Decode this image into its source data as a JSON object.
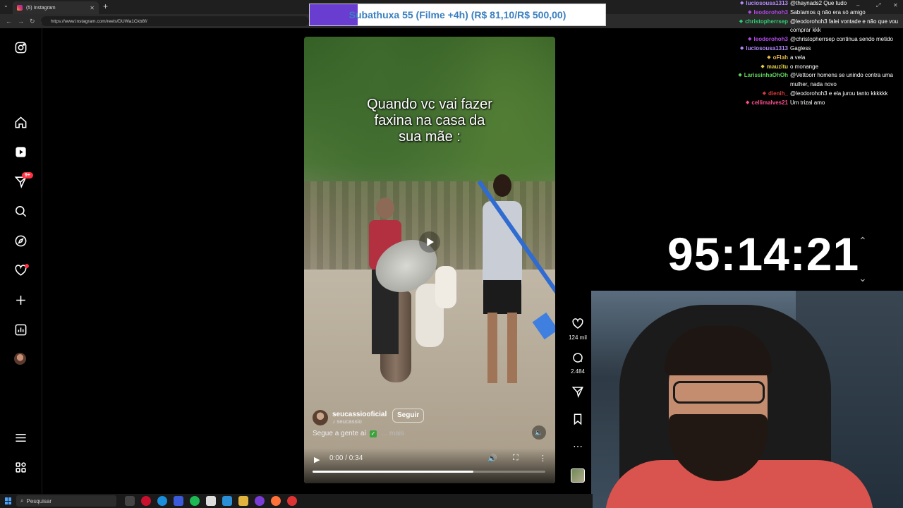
{
  "browser": {
    "tab_title": "(5) Instagram",
    "url": "https://www.instagram.com/reels/DUWa1Ckb8f/"
  },
  "banner": {
    "text": "Subathuxa 55 (Filme +4h) (R$ 81,10/R$ 500,00)",
    "progress_fraction": 0.162
  },
  "sidebar": {
    "items": [
      "instagram-logo-icon",
      "home-icon",
      "reels-icon",
      "messages-icon",
      "search-icon",
      "explore-icon",
      "notifications-icon",
      "create-icon",
      "dashboard-icon",
      "profile-avatar",
      "menu-icon",
      "more-apps-icon"
    ],
    "messages_badge": "9+"
  },
  "reel": {
    "caption_lines": [
      "Quando vc vai fazer",
      "faxina na casa da",
      "sua mãe :"
    ],
    "author": "seucassiooficial",
    "author_sub": "seucassio",
    "follow_label": "Seguir",
    "description": "Segue a gente aí",
    "more_label": "... mais",
    "time": "0:00 / 0:34",
    "progress_fraction": 0.69,
    "likes": "124 mil",
    "comments": "2.484"
  },
  "chat": [
    {
      "user": "luciosousa1313",
      "msg": "@thaynads2 Que tudo",
      "color": "#b58cff"
    },
    {
      "user": "leodorohoh3",
      "msg": "Sabíamos q não era só amigo",
      "color": "#b04be6"
    },
    {
      "user": "christopherrsep",
      "msg": "@leodorohoh3 falei vontade e não que vou",
      "msg2": "comprar kkk",
      "color": "#2ecc71"
    },
    {
      "user": "leodorohoh3",
      "msg": "@christopherrsep continua sendo metido",
      "color": "#b04be6"
    },
    {
      "user": "luciosousa1313",
      "msg": "Gagless",
      "color": "#b58cff"
    },
    {
      "user": "oFlah",
      "msg": "a vela",
      "color": "#e6b84b"
    },
    {
      "user": "mauzitu",
      "msg": "o monange",
      "color": "#e6d04b"
    },
    {
      "user": "LarissinhaOhOh",
      "msg": "@Vettoorr homens se unindo contra uma",
      "msg2": "mulher, nada novo",
      "color": "#5fd35f"
    },
    {
      "user": "dienih_",
      "msg": "@leodorohoh3 e ela jurou tanto kkkkkk",
      "color": "#d63b3b"
    },
    {
      "user": "cellimalves21",
      "msg": "Um trizal amo",
      "color": "#ff4f8f"
    }
  ],
  "timer": "95:14:21",
  "taskbar": {
    "search_placeholder": "Pesquisar"
  }
}
